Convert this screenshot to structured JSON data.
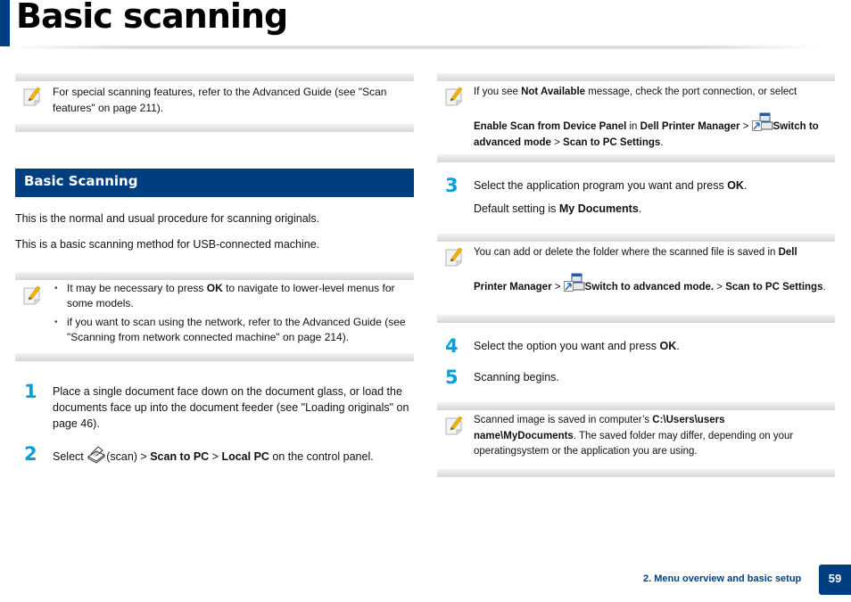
{
  "header": {
    "title": "Basic scanning"
  },
  "left": {
    "note1": {
      "text": "For special scanning features, refer to the Advanced Guide (see \"Scan features\" on page 211)."
    },
    "section_title": "Basic Scanning",
    "para1": "This is the normal and usual procedure for scanning originals.",
    "para2": "This is a basic scanning method for USB-connected machine.",
    "note2": {
      "bullet1": {
        "pre": "It may be necessary to press ",
        "bold": "OK",
        "post": " to navigate to lower-level menus for some models."
      },
      "bullet2": {
        "text": "if you want to scan using the network, refer to the Advanced Guide (see \"Scanning from network connected machine\" on page 214)."
      }
    },
    "step1": {
      "num": "1",
      "text": "Place a single document face down on the document glass, or load the documents face up into the document feeder (see \"Loading originals\" on page 46)."
    },
    "step2": {
      "num": "2",
      "pre": "Select ",
      "icon_label": "(scan) > ",
      "bold1": "Scan to PC",
      "sep": " > ",
      "bold2": "Local PC",
      "post": " on the control panel."
    }
  },
  "right": {
    "note1": {
      "pre": "If you see ",
      "bold1": "Not Available",
      "mid": " message, check the port connection, or select",
      "bold2": "Enable Scan from Device Panel",
      "in": " in ",
      "bold3": "Dell Printer Manager",
      "gt1": " > ",
      "bold4": "Switch to advanced mode",
      "gt2": " > ",
      "bold5": "Scan to PC Settings",
      "end": "."
    },
    "step3": {
      "num": "3",
      "pre": "Select the application program you want and press ",
      "bold": "OK",
      "post": ".",
      "sub_pre": "Default setting is ",
      "sub_bold": "My Documents",
      "sub_post": "."
    },
    "note2": {
      "pre": "You can add or delete the folder where the scanned file is saved in ",
      "bold1": "Dell Printer Manager",
      "gt1": " > ",
      "bold2": "Switch to advanced mode.",
      "gt2": " > ",
      "bold3": "Scan to PC Settings",
      "end": "."
    },
    "step4": {
      "num": "4",
      "pre": "Select the option you want and press ",
      "bold": "OK",
      "post": "."
    },
    "step5": {
      "num": "5",
      "text": "Scanning begins."
    },
    "note3": {
      "pre": "Scanned image is saved in computer’s ",
      "bold": "C:\\Users\\users name\\MyDocuments",
      "post": ". The saved folder may differ, depending on your operatingsystem or the application you are using."
    }
  },
  "footer": {
    "chapter": "2. Menu overview and basic setup",
    "page": "59"
  },
  "colors": {
    "brand_blue": "#003f7f",
    "step_blue": "#00a0e0"
  }
}
